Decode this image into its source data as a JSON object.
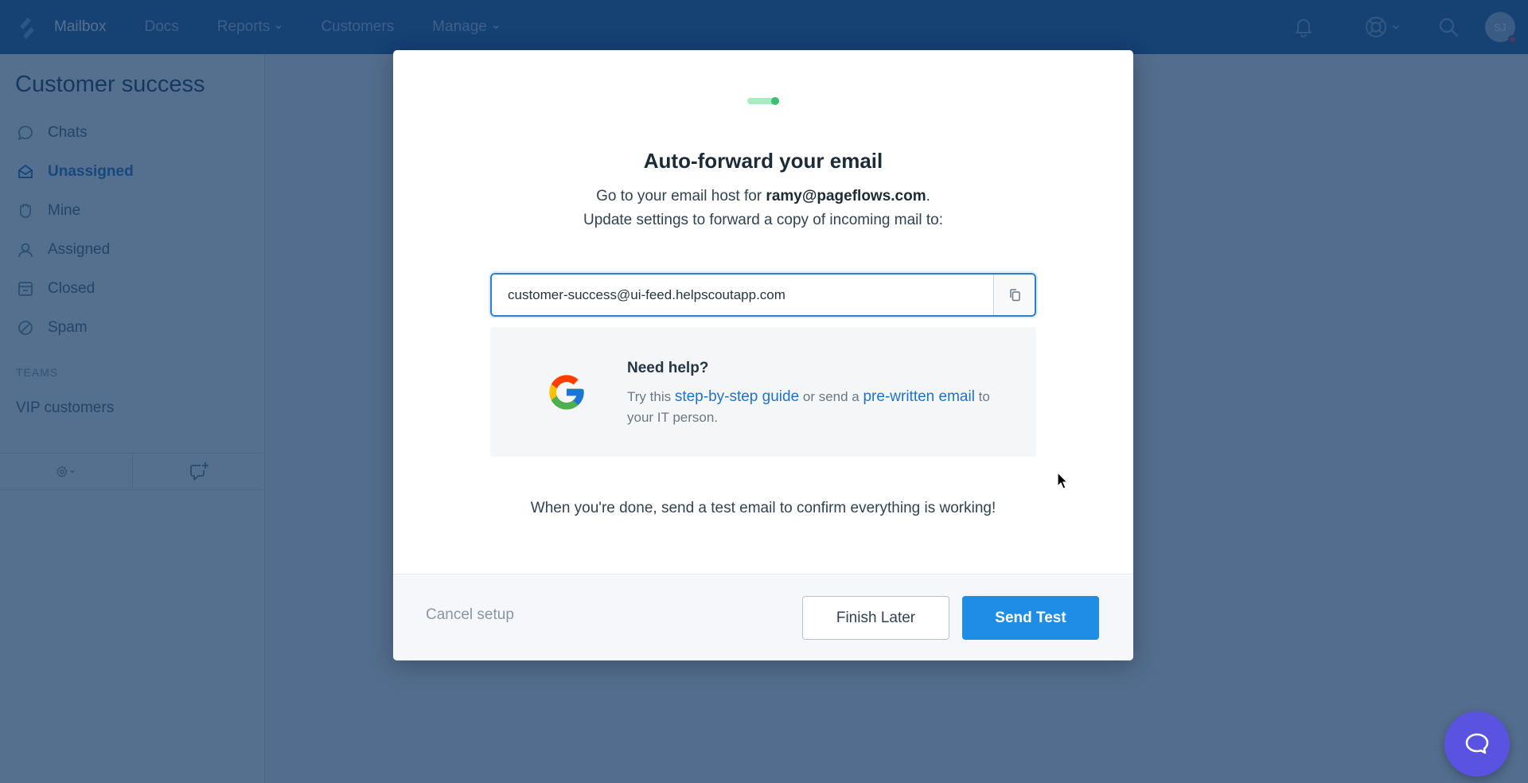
{
  "topnav": {
    "items": [
      {
        "label": "Mailbox",
        "active": true,
        "dropdown": false
      },
      {
        "label": "Docs",
        "active": false,
        "dropdown": false
      },
      {
        "label": "Reports",
        "active": false,
        "dropdown": true
      },
      {
        "label": "Customers",
        "active": false,
        "dropdown": false
      },
      {
        "label": "Manage",
        "active": false,
        "dropdown": true
      }
    ],
    "icons": [
      "bell-icon",
      "lifebuoy-icon",
      "search-icon"
    ],
    "avatar": {
      "initials": "SJ",
      "status_color": "#e0434d"
    }
  },
  "sidebar": {
    "title": "Customer success",
    "items": [
      {
        "label": "Chats",
        "icon": "chat-bubble-icon",
        "active": false
      },
      {
        "label": "Unassigned",
        "icon": "envelope-open-icon",
        "active": true
      },
      {
        "label": "Mine",
        "icon": "hand-icon",
        "active": false
      },
      {
        "label": "Assigned",
        "icon": "user-icon",
        "active": false
      },
      {
        "label": "Closed",
        "icon": "archive-icon",
        "active": false
      },
      {
        "label": "Spam",
        "icon": "ban-icon",
        "active": false
      }
    ],
    "teams_label": "TEAMS",
    "teams": [
      {
        "label": "VIP customers"
      }
    ],
    "toolbar": [
      "gear-dropdown-icon",
      "new-conversation-icon"
    ]
  },
  "modal": {
    "progress": 1.0,
    "title": "Auto-forward your email",
    "subtitle_line1_prefix": "Go to your email host for ",
    "subtitle_email": "ramy@pageflows.com",
    "subtitle_line1_suffix": ".",
    "subtitle_line2": "Update settings to forward a copy of incoming mail to:",
    "forward_address": "customer-success@ui-feed.helpscoutapp.com",
    "help": {
      "title": "Need help?",
      "text_prefix": "Try this ",
      "link1": "step-by-step guide",
      "text_mid": " or send a ",
      "link2": "pre-written email",
      "text_suffix": " to your IT person."
    },
    "done_text": "When you're done, send a test email to confirm everything is working!",
    "footer": {
      "cancel": "Cancel setup",
      "finish_later": "Finish Later",
      "send_test": "Send Test"
    }
  },
  "colors": {
    "accent": "#1f8ce6",
    "link": "#1f73c6",
    "nav_bg": "#1b5a9c",
    "progress": "#3ebf78",
    "beacon": "#5a52e0"
  }
}
